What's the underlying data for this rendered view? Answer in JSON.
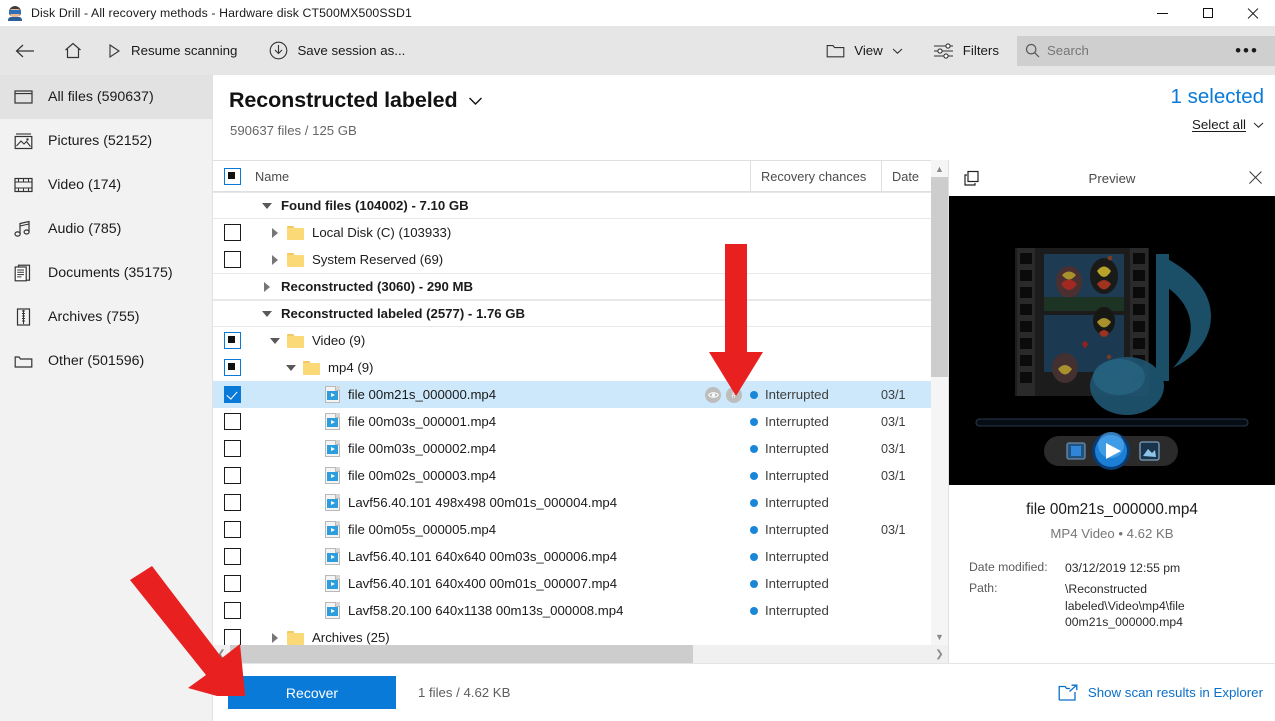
{
  "window": {
    "title": "Disk Drill - All recovery methods - Hardware disk CT500MX500SSD1",
    "minimize_label": "Minimize",
    "maximize_label": "Maximize",
    "close_label": "Close"
  },
  "toolbar": {
    "back_label": "Back",
    "home_label": "Home",
    "resume_label": "Resume scanning",
    "save_session_label": "Save session as...",
    "view_label": "View",
    "filters_label": "Filters",
    "more_label": "•••",
    "search": {
      "value": "",
      "placeholder": "Search"
    }
  },
  "sidebar": {
    "items": [
      {
        "label": "All files (590637)",
        "icon": "all-files-icon",
        "active": true
      },
      {
        "label": "Pictures (52152)",
        "icon": "pictures-icon",
        "active": false
      },
      {
        "label": "Video (174)",
        "icon": "video-icon",
        "active": false
      },
      {
        "label": "Audio (785)",
        "icon": "audio-icon",
        "active": false
      },
      {
        "label": "Documents (35175)",
        "icon": "documents-icon",
        "active": false
      },
      {
        "label": "Archives (755)",
        "icon": "archives-icon",
        "active": false
      },
      {
        "label": "Other (501596)",
        "icon": "other-icon",
        "active": false
      }
    ]
  },
  "header": {
    "title": "Reconstructed labeled",
    "subtitle": "590637 files / 125 GB",
    "selected_count": "1 selected",
    "select_all": "Select all"
  },
  "table": {
    "columns": {
      "name": "Name",
      "recovery": "Recovery chances",
      "date": "Date"
    },
    "rows": [
      {
        "type": "group",
        "indent": 0,
        "twisty": "down",
        "check": "none",
        "icon": "none",
        "label": "Found files (104002) - 7.10 GB",
        "recovery": "",
        "date": ""
      },
      {
        "type": "folder",
        "indent": 1,
        "twisty": "right",
        "check": "empty",
        "icon": "folder",
        "label": "Local Disk (C) (103933)",
        "recovery": "",
        "date": ""
      },
      {
        "type": "folder",
        "indent": 1,
        "twisty": "right",
        "check": "empty",
        "icon": "folder",
        "label": "System Reserved (69)",
        "recovery": "",
        "date": ""
      },
      {
        "type": "group",
        "indent": 0,
        "twisty": "right",
        "check": "none",
        "icon": "none",
        "label": "Reconstructed (3060) - 290 MB",
        "recovery": "",
        "date": ""
      },
      {
        "type": "group",
        "indent": 0,
        "twisty": "down",
        "check": "none",
        "icon": "none",
        "label": "Reconstructed labeled (2577) - 1.76 GB",
        "recovery": "",
        "date": ""
      },
      {
        "type": "folder",
        "indent": 1,
        "twisty": "down",
        "check": "partial",
        "icon": "folder",
        "label": "Video (9)",
        "recovery": "",
        "date": ""
      },
      {
        "type": "folder",
        "indent": 2,
        "twisty": "down",
        "check": "partial",
        "icon": "folder",
        "label": "mp4 (9)",
        "recovery": "",
        "date": ""
      },
      {
        "type": "file",
        "indent": 3,
        "twisty": "none",
        "check": "checked",
        "icon": "video-file",
        "label": "file 00m21s_000000.mp4",
        "recovery": "Interrupted",
        "date": "03/1",
        "selected": true,
        "hover_icons": true
      },
      {
        "type": "file",
        "indent": 3,
        "twisty": "none",
        "check": "empty",
        "icon": "video-file",
        "label": "file 00m03s_000001.mp4",
        "recovery": "Interrupted",
        "date": "03/1"
      },
      {
        "type": "file",
        "indent": 3,
        "twisty": "none",
        "check": "empty",
        "icon": "video-file",
        "label": "file 00m03s_000002.mp4",
        "recovery": "Interrupted",
        "date": "03/1"
      },
      {
        "type": "file",
        "indent": 3,
        "twisty": "none",
        "check": "empty",
        "icon": "video-file",
        "label": "file 00m02s_000003.mp4",
        "recovery": "Interrupted",
        "date": "03/1"
      },
      {
        "type": "file",
        "indent": 3,
        "twisty": "none",
        "check": "empty",
        "icon": "video-file",
        "label": "Lavf56.40.101 498x498 00m01s_000004.mp4",
        "recovery": "Interrupted",
        "date": ""
      },
      {
        "type": "file",
        "indent": 3,
        "twisty": "none",
        "check": "empty",
        "icon": "video-file",
        "label": "file 00m05s_000005.mp4",
        "recovery": "Interrupted",
        "date": "03/1"
      },
      {
        "type": "file",
        "indent": 3,
        "twisty": "none",
        "check": "empty",
        "icon": "video-file",
        "label": "Lavf56.40.101 640x640 00m03s_000006.mp4",
        "recovery": "Interrupted",
        "date": ""
      },
      {
        "type": "file",
        "indent": 3,
        "twisty": "none",
        "check": "empty",
        "icon": "video-file",
        "label": "Lavf56.40.101 640x400 00m01s_000007.mp4",
        "recovery": "Interrupted",
        "date": ""
      },
      {
        "type": "file",
        "indent": 3,
        "twisty": "none",
        "check": "empty",
        "icon": "video-file",
        "label": "Lavf58.20.100 640x1138 00m13s_000008.mp4",
        "recovery": "Interrupted",
        "date": ""
      },
      {
        "type": "folder",
        "indent": 1,
        "twisty": "right",
        "check": "empty",
        "icon": "folder",
        "label": "Archives (25)",
        "recovery": "",
        "date": ""
      }
    ]
  },
  "preview": {
    "header_title": "Preview",
    "copy_icon_label": "Open in new window",
    "close_label": "Close preview",
    "file_name": "file 00m21s_000000.mp4",
    "file_type": "MP4 Video • 4.62 KB",
    "fields": [
      {
        "key": "Date modified:",
        "value": "03/12/2019 12:55 pm"
      },
      {
        "key": "Path:",
        "value": "\\Reconstructed labeled\\Video\\mp4\\file 00m21s_000000.mp4"
      }
    ]
  },
  "footer": {
    "recover_label": "Recover",
    "file_count": "1 files / 4.62 KB",
    "show_explorer_label": "Show scan results in Explorer"
  },
  "colors": {
    "accent": "#0a7ad8",
    "selection": "#cde8fa",
    "toolbar_bg": "#e6e6e6",
    "sidebar_bg": "#f2f2f2",
    "annotation_red": "#e82020",
    "status_dot": "#1a86d8"
  }
}
